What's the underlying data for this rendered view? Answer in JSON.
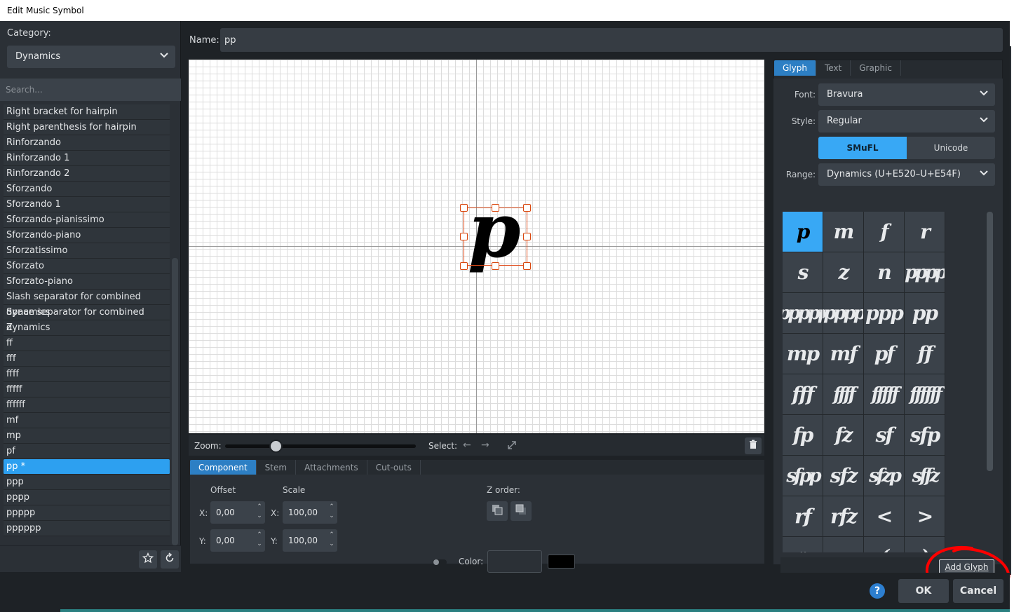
{
  "window": {
    "title": "Edit Music Symbol"
  },
  "category": {
    "label": "Category:",
    "value": "Dynamics"
  },
  "search": {
    "placeholder": "Search..."
  },
  "symbols": [
    "Right bracket for hairpin",
    "Right parenthesis for hairpin",
    "Rinforzando",
    "Rinforzando 1",
    "Rinforzando 2",
    "Sforzando",
    "Sforzando 1",
    "Sforzando-pianissimo",
    "Sforzando-piano",
    "Sforzatissimo",
    "Sforzato",
    "Sforzato-piano",
    "Slash separator for combined dynamics",
    "Space separator for combined dynamics",
    "Z",
    "ff",
    "fff",
    "ffff",
    "fffff",
    "ffffff",
    "mf",
    "mp",
    "pf",
    "pp *",
    "ppp",
    "pppp",
    "ppppp",
    "pppppp"
  ],
  "selected_symbol": "pp *",
  "name": {
    "label": "Name:",
    "value": "pp"
  },
  "canvas": {
    "glyph": "p"
  },
  "zoom": {
    "label": "Zoom:",
    "select_label": "Select:"
  },
  "component_tabs": [
    "Component",
    "Stem",
    "Attachments",
    "Cut-outs"
  ],
  "component": {
    "offset_label": "Offset",
    "scale_label": "Scale",
    "x_label": "X:",
    "y_label": "Y:",
    "offset_x": "0,00",
    "offset_y": "0,00",
    "scale_x": "100,00",
    "scale_y": "100,00",
    "zorder_label": "Z order:",
    "color_label": "Color:"
  },
  "right_tabs": [
    "Glyph",
    "Text",
    "Graphic"
  ],
  "glyph": {
    "font_label": "Font:",
    "font": "Bravura",
    "style_label": "Style:",
    "style": "Regular",
    "mode_smufl": "SMuFL",
    "mode_unicode": "Unicode",
    "range_label": "Range:",
    "range": "Dynamics (U+E520–U+E54F)",
    "cells": [
      "p",
      "m",
      "f",
      "r",
      "s",
      "z",
      "n",
      "pppp",
      "ppppp",
      "pppppp",
      "ppp",
      "pp",
      "mp",
      "mf",
      "pf",
      "ff",
      "fff",
      "ffff",
      "fffff",
      "ffffff",
      "fp",
      "fz",
      "sf",
      "sfp",
      "sfpp",
      "sfz",
      "sfzp",
      "sffz",
      "rf",
      "rfz",
      "<",
      ">",
      "<>",
      "",
      "(",
      ")"
    ],
    "add_button": "Add Glyph"
  },
  "buttons": {
    "help": "?",
    "ok": "OK",
    "cancel": "Cancel"
  },
  "colors": {
    "accent": "#38a8f5",
    "selection": "#e04b1a",
    "annotation": "#ff0000"
  }
}
